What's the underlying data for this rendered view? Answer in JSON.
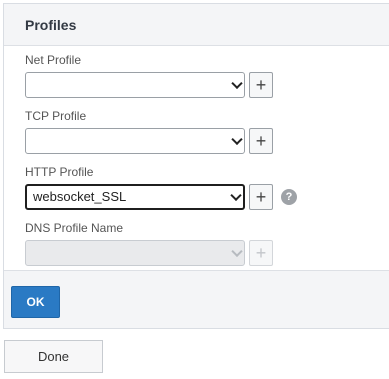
{
  "panel": {
    "title": "Profiles"
  },
  "fields": [
    {
      "label": "Net Profile",
      "value": "",
      "state": "enabled",
      "help": false
    },
    {
      "label": "TCP Profile",
      "value": "",
      "state": "enabled",
      "help": false
    },
    {
      "label": "HTTP Profile",
      "value": "websocket_SSL",
      "state": "focused",
      "help": true
    },
    {
      "label": "DNS Profile Name",
      "value": "",
      "state": "disabled",
      "help": false
    }
  ],
  "icons": {
    "add": "+",
    "help": "?",
    "dropdown": "chevron-down-icon"
  },
  "buttons": {
    "ok": "OK",
    "done": "Done"
  },
  "colors": {
    "primary": "#2a7ac4",
    "header_bg": "#f4f5f7"
  }
}
